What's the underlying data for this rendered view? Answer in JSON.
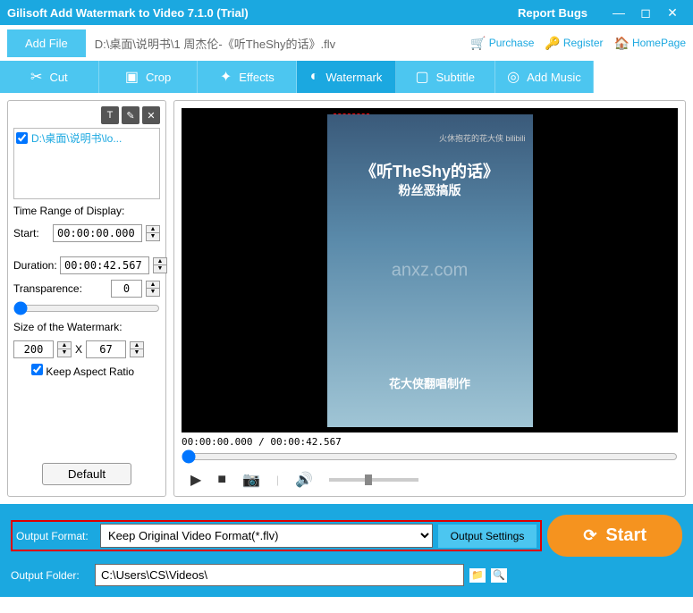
{
  "titlebar": {
    "title": "Gilisoft Add Watermark to Video 7.1.0 (Trial)",
    "report": "Report Bugs"
  },
  "toolbar": {
    "add_file": "Add File",
    "filepath": "D:\\桌面\\说明书\\1 周杰伦-《听TheShy的话》.flv",
    "purchase": "Purchase",
    "register": "Register",
    "homepage": "HomePage"
  },
  "tabs": {
    "cut": "Cut",
    "crop": "Crop",
    "effects": "Effects",
    "watermark": "Watermark",
    "subtitle": "Subtitle",
    "add_music": "Add Music"
  },
  "sidebar": {
    "file": "D:\\桌面\\说明书\\lo...",
    "time_range_label": "Time Range of Display:",
    "start_label": "Start:",
    "start_value": "00:00:00.000",
    "duration_label": "Duration:",
    "duration_value": "00:00:42.567",
    "transparence_label": "Transparence:",
    "transparence_value": "0",
    "size_label": "Size of the Watermark:",
    "size_w": "200",
    "size_x": "X",
    "size_h": "67",
    "keep_aspect": "Keep Aspect Ratio",
    "default_btn": "Default"
  },
  "preview": {
    "wm_top": "火休抱花的花大侠  bilibili",
    "line1": "《听TheShy的话》",
    "line2": "粉丝恶搞版",
    "wm_mid": "anxz.com",
    "line3": "花大侠翻唱制作",
    "timecode": "00:00:00.000 / 00:00:42.567"
  },
  "bottom": {
    "output_format_label": "Output Format:",
    "output_format_value": "Keep Original Video Format(*.flv)",
    "output_settings": "Output Settings",
    "output_folder_label": "Output Folder:",
    "output_folder_value": "C:\\Users\\CS\\Videos\\",
    "start": "Start"
  }
}
